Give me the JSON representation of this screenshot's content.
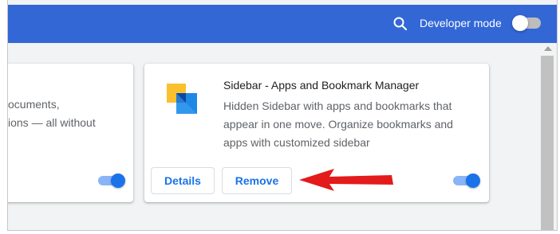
{
  "header": {
    "developer_mode_label": "Developer mode",
    "developer_mode_on": false,
    "background_color": "#3367d6"
  },
  "cards": [
    {
      "description_lines": [
        "ocuments,",
        "ions — all without"
      ],
      "enabled": true
    },
    {
      "name": "Sidebar - Apps and Bookmark Manager",
      "description_lines": [
        "Hidden Sidebar with apps and bookmarks that",
        "appear in one move. Organize bookmarks and",
        "apps with customized sidebar"
      ],
      "details_label": "Details",
      "remove_label": "Remove",
      "enabled": true
    }
  ],
  "annotation": {
    "arrow_color": "#e31b1b",
    "points_to": "remove-button"
  },
  "colors": {
    "accent": "#1a73e8",
    "toggle_track": "#8ab4f8"
  }
}
